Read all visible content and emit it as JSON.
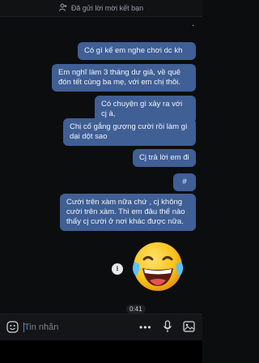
{
  "header": {
    "status_text": "Đã gửi lời mời kết bạn",
    "icon": "add-friend-icon"
  },
  "messages": [
    {
      "side": "right",
      "text": "."
    },
    {
      "side": "right",
      "text": "Có gì kể em nghe chơi dc kh"
    },
    {
      "side": "right",
      "text": "Em nghĩ làm 3 tháng dư giả, về quê đón tết cùng ba mẹ, với em chị thôi."
    },
    {
      "side": "right",
      "text": "Có chuyện gì xảy ra với cj à,"
    },
    {
      "side": "right",
      "text": "Chị cố gắng gượng cười rồi làm gì dại dột sao"
    },
    {
      "side": "right",
      "text": "Cj trả lời em đi"
    },
    {
      "side": "right",
      "text": "#"
    },
    {
      "side": "right",
      "text": "Cười trên xàm nữa chứ , cj không cười trên xàm. Thì em đâu thể nào thấy cj cười ở nơi khác được nữa."
    }
  ],
  "sticker": {
    "type": "laughing-emoji",
    "play_icon": "download-icon"
  },
  "timestamp": "0:41",
  "composer": {
    "placeholder": "Tin nhắn",
    "value": "",
    "icons": [
      "emoji-icon",
      "more-icon",
      "mic-icon",
      "image-icon"
    ]
  },
  "colors": {
    "bubble": "#3f5f95",
    "background": "#0c0d0f",
    "accent": "#3d8bff"
  }
}
